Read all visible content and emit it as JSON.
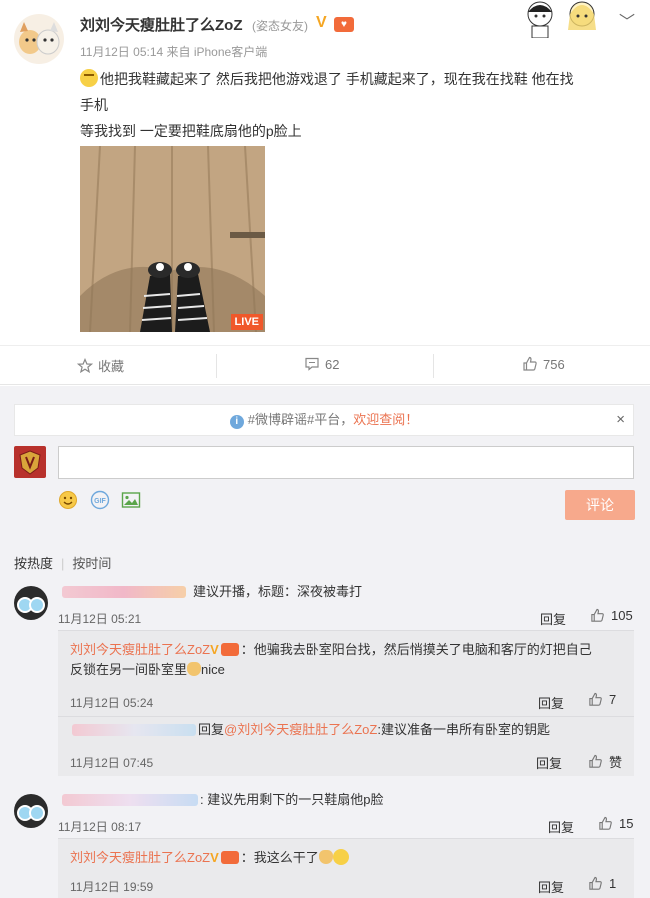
{
  "post": {
    "user_name": "刘刘今天瘦肚肚了么ZoZ",
    "user_tag": "(姿态女友)",
    "verified_mark": "V",
    "meta": "11月12日 05:14 来自 iPhone客户端",
    "text_line1": "他把我鞋藏起来了 然后我把他游戏退了 手机藏起来了，现在我在找鞋 他在找",
    "text_line2": "手机",
    "text_line3": "等我找到 一定要把鞋底扇他的p脸上",
    "live_badge": "LIVE"
  },
  "actions": {
    "favorite": "收藏",
    "comments": "62",
    "likes": "756"
  },
  "comments_section": {
    "notice_prefix": "#微博辟谣#平台，",
    "notice_highlight": "欢迎查阅！",
    "notice_close": "×",
    "submit_label": "评论",
    "sort_hot": "按热度",
    "sort_time": "按时间"
  },
  "comments": [
    {
      "text": "建议开播，标题：深夜被毒打",
      "time": "11月12日 05:21",
      "reply_label": "回复",
      "likes": "105"
    },
    {
      "author": "刘刘今天瘦肚肚了么ZoZ",
      "text_a": "：他骗我去卧室阳台找，然后悄摸关了电脑和客厅的灯把自己",
      "text_b": "反锁在另一间卧室里",
      "text_c": "nice",
      "time": "11月12日 05:24",
      "reply_label": "回复",
      "likes": "7"
    },
    {
      "prefix": "回复",
      "mention": "@刘刘今天瘦肚肚了么ZoZ",
      "text": ":建议准备一串所有卧室的钥匙",
      "time": "11月12日 07:45",
      "reply_label": "回复",
      "likes": "赞"
    },
    {
      "text": "建议先用剩下的一只鞋扇他p脸",
      "time": "11月12日 08:17",
      "reply_label": "回复",
      "likes": "15"
    },
    {
      "author": "刘刘今天瘦肚肚了么ZoZ",
      "text": "：我这么干了",
      "time": "11月12日 19:59",
      "reply_label": "回复",
      "likes": "1"
    }
  ]
}
